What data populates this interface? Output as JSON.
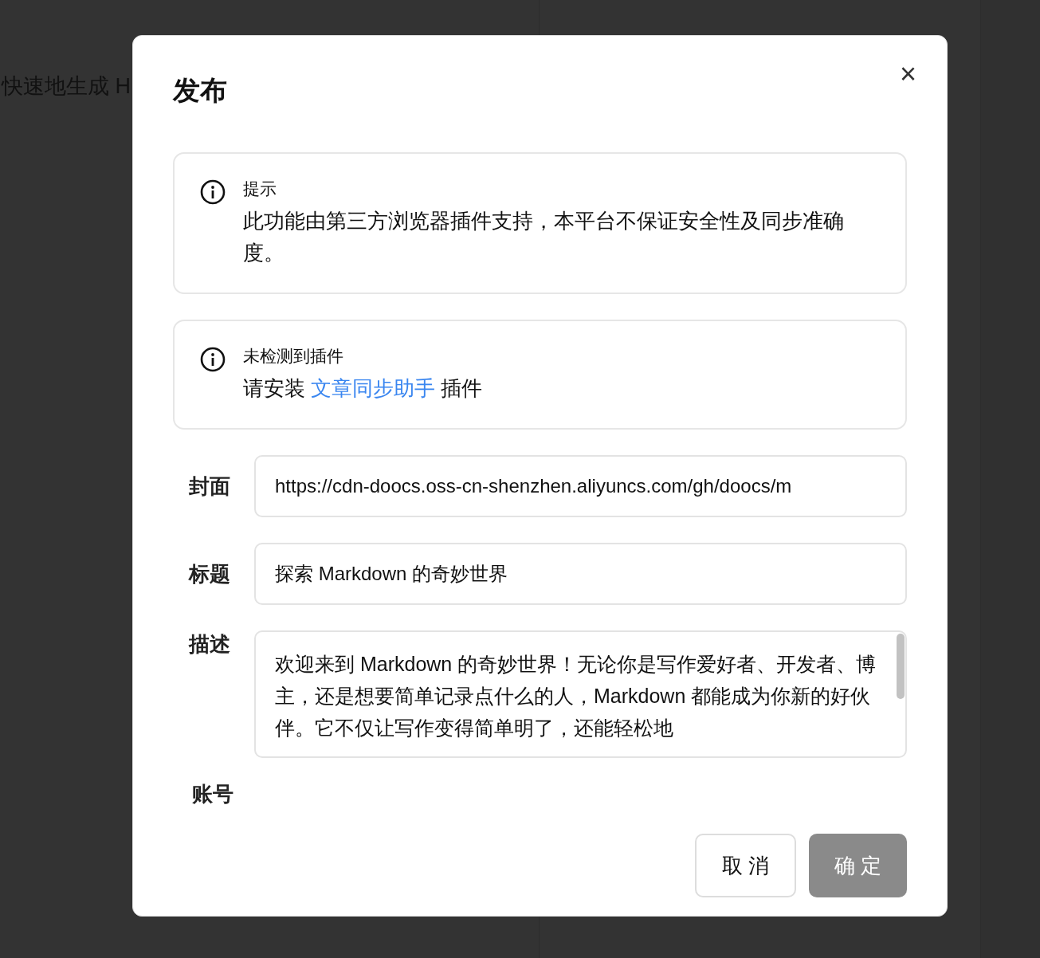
{
  "background": {
    "text": "快速地生成 H"
  },
  "dialog": {
    "title": "发布",
    "close_icon": "×",
    "alerts": [
      {
        "title": "提示",
        "parts": [
          {
            "kind": "text",
            "text": "此功能由第三方浏览器插件支持，本平台不保证安全性及同步准确度。"
          }
        ]
      },
      {
        "title": "未检测到插件",
        "parts": [
          {
            "kind": "text",
            "text": "请安装 "
          },
          {
            "kind": "link",
            "text": "文章同步助手"
          },
          {
            "kind": "text",
            "text": " 插件"
          }
        ]
      }
    ],
    "fields": [
      {
        "kind": "input",
        "label": "封面",
        "value": "https://cdn-doocs.oss-cn-shenzhen.aliyuncs.com/gh/doocs/m"
      },
      {
        "kind": "input",
        "label": "标题",
        "value": "探索 Markdown 的奇妙世界"
      },
      {
        "kind": "textarea",
        "label": "描述",
        "value": "欢迎来到 Markdown 的奇妙世界！无论你是写作爱好者、开发者、博主，还是想要简单记录点什么的人，Markdown 都能成为你新的好伙伴。它不仅让写作变得简单明了，还能轻松地"
      },
      {
        "kind": "accounts",
        "label": "账号"
      }
    ],
    "buttons": [
      {
        "label": "取 消",
        "kind": "cancel",
        "disabled": false
      },
      {
        "label": "确 定",
        "kind": "primary",
        "disabled": true
      }
    ]
  }
}
